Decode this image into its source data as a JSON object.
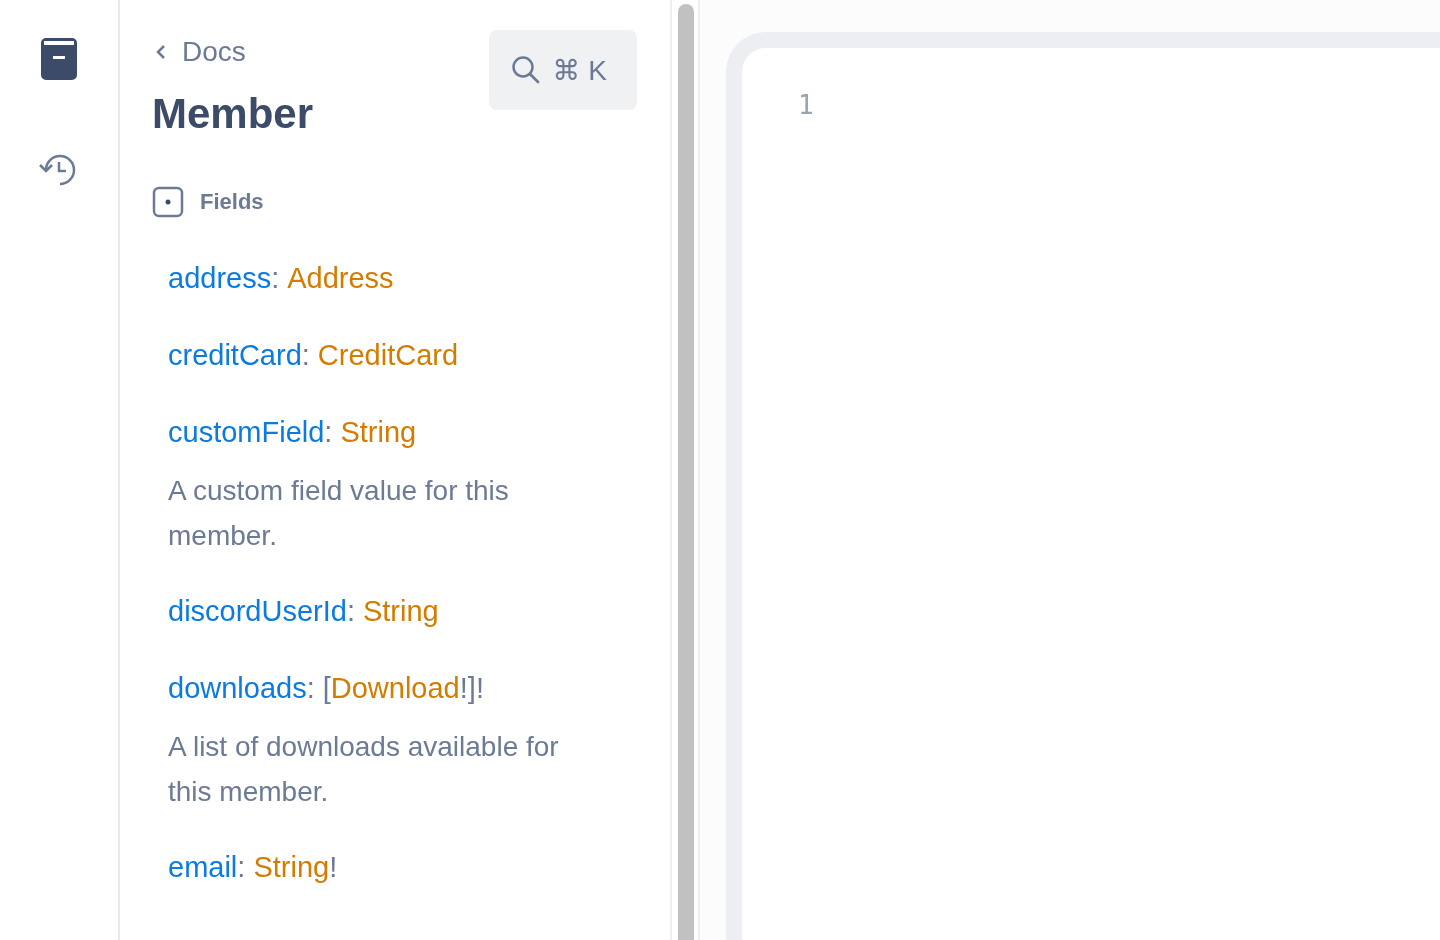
{
  "rail": {
    "items": [
      {
        "kind": "docs",
        "selected": true
      },
      {
        "kind": "history",
        "selected": false
      }
    ]
  },
  "docs": {
    "back_label": "Docs",
    "search_shortcut": "⌘ K",
    "title": "Member",
    "section": "Fields",
    "fields": [
      {
        "name": "address",
        "separator": ":",
        "type": "Address"
      },
      {
        "name": "creditCard",
        "separator": ":",
        "type": "CreditCard"
      },
      {
        "name": "customField",
        "separator": ":",
        "type": "String",
        "description": "A custom field value for this member."
      },
      {
        "name": "discordUserId",
        "separator": ":",
        "type": "String"
      },
      {
        "name": "downloads",
        "separator": ":",
        "before": "[",
        "type": "Download",
        "after": "!]!",
        "description": "A list of downloads available for this member."
      },
      {
        "name": "email",
        "separator": ":",
        "type": "String",
        "after": "!"
      }
    ]
  },
  "editor": {
    "line_numbers": [
      "1"
    ]
  }
}
